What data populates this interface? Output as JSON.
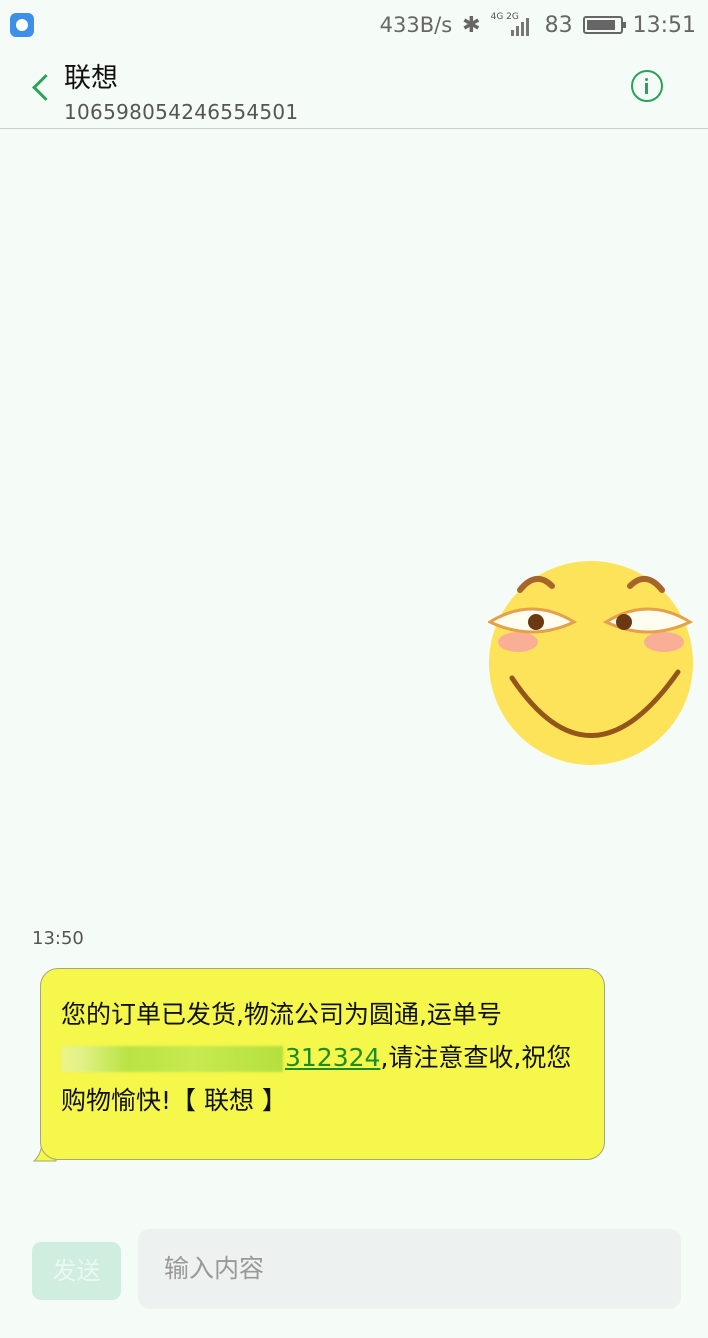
{
  "status_bar": {
    "net_speed": "433B/s",
    "network_labels": "4G 2G",
    "battery": "83",
    "time": "13:51",
    "icons": [
      "app-notification-icon",
      "bluetooth-icon",
      "signal-icon",
      "battery-icon"
    ]
  },
  "header": {
    "contact_name": "联想",
    "contact_number": "106598054246554501",
    "accent_color": "#27a35a"
  },
  "conversation": {
    "timestamp": "13:50",
    "message": {
      "line1": "您的订单已发货,物流公司为圆通,运单号",
      "tracking_suffix": "312324",
      "line2_rest": ",请注意查收,祝您",
      "line3": "购物愉快!【 联想 】",
      "bubble_color": "#f5f74a"
    }
  },
  "composer": {
    "send_label": "发送",
    "input_placeholder": "输入内容"
  }
}
